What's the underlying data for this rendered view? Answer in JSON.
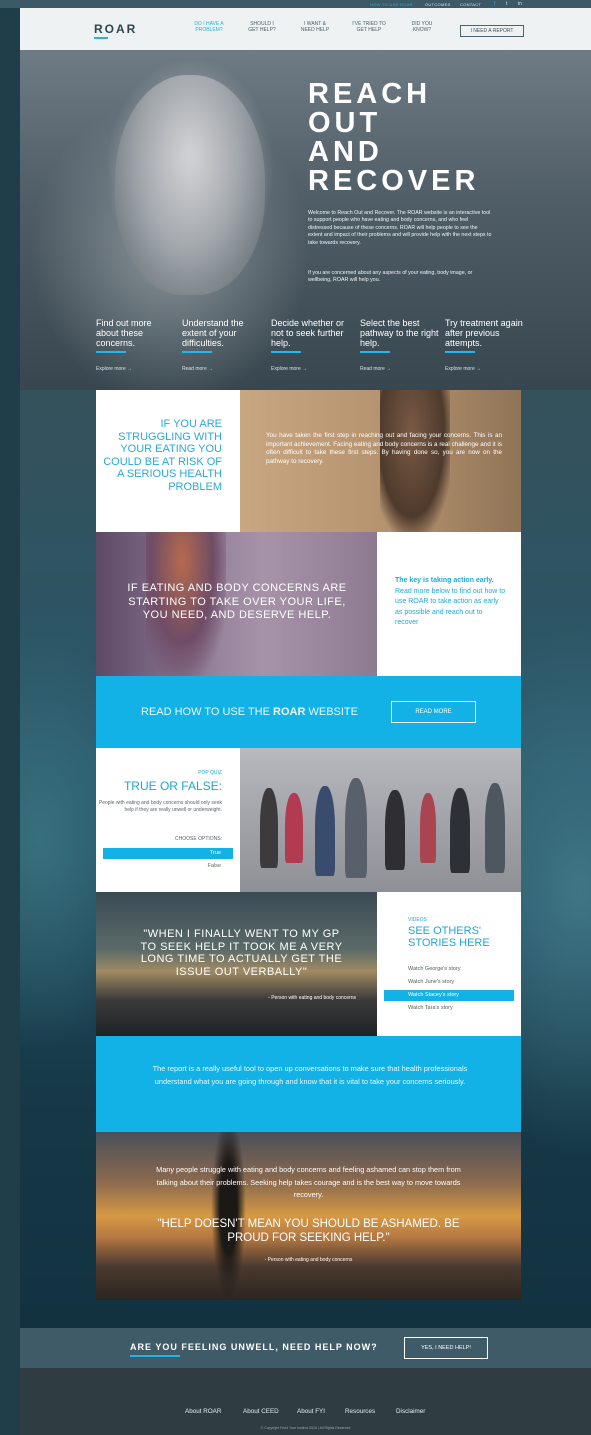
{
  "topbar": {
    "links": [
      "HOW TO USE ROAR",
      "OUTCOMES",
      "CONTACT"
    ],
    "social": [
      "f",
      "t",
      "in"
    ]
  },
  "nav": {
    "logo": "ROAR",
    "items": [
      {
        "line1": "DO I HAVE A",
        "line2": "PROBLEM?",
        "active": true
      },
      {
        "line1": "SHOULD I",
        "line2": "GET HELP?",
        "active": false
      },
      {
        "line1": "I WANT &",
        "line2": "NEED HELP",
        "active": false
      },
      {
        "line1": "I'VE TRIED TO",
        "line2": "GET HELP",
        "active": false
      },
      {
        "line1": "DID YOU",
        "line2": "KNOW?",
        "active": false
      }
    ],
    "report_button": "I NEED A REPORT"
  },
  "hero": {
    "title": "REACH\nOUT\nAND\nRECOVER",
    "para1": "Welcome to Reach Out and Recover. The ROAR website is an interactive tool to support people who have eating and body concerns, and who feel distressed because of these concerns. ROAR will help people to see the extent and impact of their problems and will provide help with the next steps to take towards recovery.",
    "para2": "If you are concerned about any aspects of your eating, body image, or wellbeing, ROAR will help you.",
    "pillars": [
      {
        "title": "Find out more about these concerns.",
        "link": "Explore more →"
      },
      {
        "title": "Understand the extent of your difficulties.",
        "link": "Read more →"
      },
      {
        "title": "Decide whether or not to seek further help.",
        "link": "Explore more →"
      },
      {
        "title": "Select the best pathway to the right help.",
        "link": "Read more →"
      },
      {
        "title": "Try treatment again after previous attempts.",
        "link": "Explore more →"
      }
    ]
  },
  "block1": {
    "heading": "IF YOU ARE STRUGGLING WITH YOUR EATING YOU COULD BE AT RISK OF A SERIOUS HEALTH PROBLEM",
    "body": "You have taken the first step in reaching out and facing your concerns. This is an important achievement. Facing eating and body concerns is a real challenge and it is often difficult to take these first steps. By having done so, you are now on the pathway to recovery."
  },
  "block2": {
    "statement": "IF EATING AND BODY CONCERNS ARE STARTING TO TAKE OVER YOUR LIFE, YOU NEED, AND DESERVE HELP.",
    "key_bold": "The key is taking action early.",
    "key_body": "Read more below to find out how to use ROAR to take action as early as possible and reach out to recover"
  },
  "block3": {
    "text_prefix": "READ HOW TO USE THE ",
    "text_bold": "ROAR",
    "text_suffix": " WEBSITE",
    "button": "READ MORE"
  },
  "quiz": {
    "tag": "POP QUIZ",
    "title": "TRUE OR FALSE:",
    "question": "People with eating and body concerns should only seek help if they are really unwell or underweight.",
    "choose": "CHOOSE OPTIONS:",
    "options": [
      "True",
      "False"
    ]
  },
  "quote1": {
    "text": "\"WHEN I FINALLY WENT TO MY GP TO SEEK HELP IT TOOK ME A VERY LONG TIME TO ACTUALLY GET THE ISSUE OUT VERBALLY\"",
    "cite": "- Person with eating and body concerns"
  },
  "videos": {
    "tag": "VIDEOS",
    "title": "SEE OTHERS' STORIES HERE",
    "items": [
      "Watch George's story",
      "Watch June's story",
      "Watch Stacey's story",
      "Watch Tara's story"
    ],
    "selected_index": 2
  },
  "report_block": {
    "text": "The report is a really useful tool to open up conversations to make sure that health professionals understand what you are going through and know that it is vital to take your concerns seriously."
  },
  "sunset": {
    "text": "Many people struggle with eating and body concerns and feeling ashamed can stop them from talking about their problems. Seeking help takes courage and is the best way to move towards recovery.",
    "quote": "\"HELP DOESN'T MEAN YOU SHOULD BE ASHAMED. BE PROUD FOR SEEKING HELP.\"",
    "cite": "- Person with eating and body concerns"
  },
  "cta": {
    "text": "ARE YOU FEELING UNWELL, NEED HELP NOW?",
    "button": "YES, I NEED HELP!"
  },
  "footer": {
    "links": [
      "About ROAR",
      "About CEED",
      "About FYI",
      "Resources",
      "Disclaimer"
    ],
    "copyright": "© Copyright Feed Your Instinct 2016 | All Rights Reserved"
  },
  "colors": {
    "accent": "#13b2e6",
    "dark": "#2f3d43"
  }
}
